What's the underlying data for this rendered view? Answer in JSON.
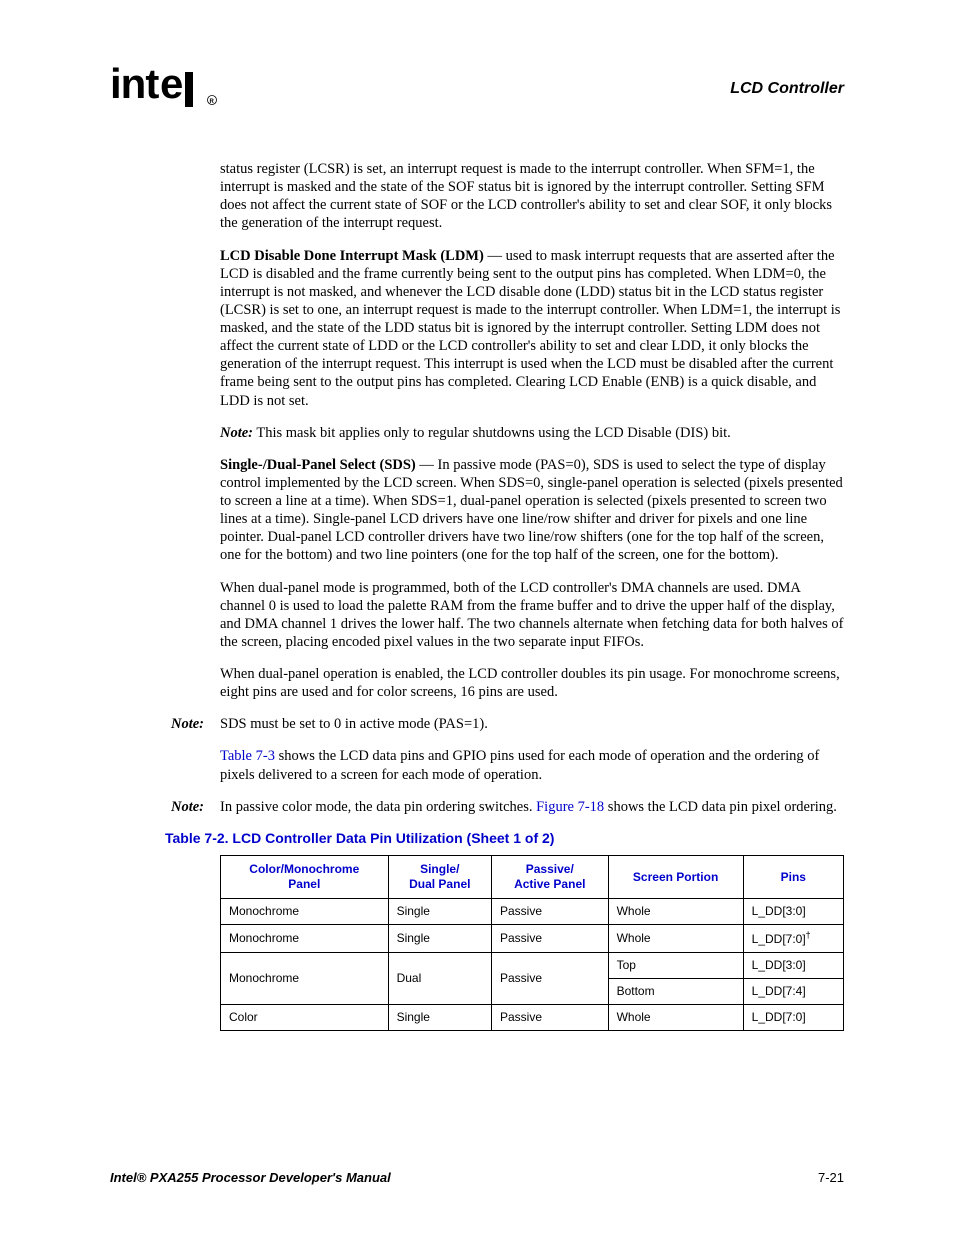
{
  "header": {
    "logo_text": "intel",
    "section_title": "LCD Controller"
  },
  "body": {
    "p1": "status register (LCSR) is set, an interrupt request is made to the interrupt controller. When SFM=1, the interrupt is masked and the state of the SOF status bit is ignored by the interrupt controller. Setting SFM does not affect the current state of SOF or the LCD controller's ability to set and clear SOF, it only blocks the generation of the interrupt request.",
    "p2_bold": "LCD Disable Done Interrupt Mask (LDM)",
    "p2_rest": " — used to mask interrupt requests that are asserted after the LCD is disabled and the frame currently being sent to the output pins has completed. When LDM=0, the interrupt is not masked, and whenever the LCD disable done (LDD) status bit in the LCD status register (LCSR) is set to one, an interrupt request is made to the interrupt controller. When LDM=1, the interrupt is masked, and the state of the LDD status bit is ignored by the interrupt controller. Setting LDM does not affect the current state of LDD or the LCD controller's ability to set and clear LDD, it only blocks the generation of the interrupt request. This interrupt is used when the LCD must be disabled after the current frame being sent to the output pins has completed. Clearing LCD Enable (ENB) is a quick disable, and LDD is not set.",
    "p3_note_label": "Note:",
    "p3_note_text": " This mask bit applies only to regular shutdowns using the LCD Disable (DIS) bit.",
    "p4_bold": "Single-/Dual-Panel Select (SDS)",
    "p4_rest": " — In passive mode (PAS=0), SDS is used to select the type of display control implemented by the LCD screen. When SDS=0, single-panel operation is selected (pixels presented to screen a line at a time). When SDS=1, dual-panel operation is selected (pixels presented to screen two lines at a time). Single-panel LCD drivers have one line/row shifter and driver for pixels and one line pointer. Dual-panel LCD controller drivers have two line/row shifters (one for the top half of the screen, one for the bottom) and two line pointers (one for the top half of the screen, one for the bottom).",
    "p5": "When dual-panel mode is programmed, both of the LCD controller's DMA channels are used. DMA channel 0 is used to load the palette RAM from the frame buffer and to drive the upper half of the display, and DMA channel 1 drives the lower half. The two channels alternate when fetching data for both halves of the screen, placing encoded pixel values in the two separate input FIFOs.",
    "p6": "When dual-panel operation is enabled, the LCD controller doubles its pin usage. For monochrome screens, eight pins are used and for color screens, 16 pins are used.",
    "note1_label": "Note:",
    "note1_text": "SDS must be set to 0 in active mode (PAS=1).",
    "p7_link": "Table 7-3",
    "p7_rest": " shows the LCD data pins and GPIO pins used for each mode of operation and the ordering of pixels delivered to a screen for each mode of operation.",
    "note2_label": "Note:",
    "note2_text_a": "In passive color mode, the data pin ordering switches. ",
    "note2_link": "Figure 7-18",
    "note2_text_b": " shows the LCD data pin pixel ordering."
  },
  "table": {
    "caption": "Table 7-2. LCD Controller Data Pin Utilization (Sheet 1 of 2)",
    "headers": {
      "h1a": "Color/Monochrome",
      "h1b": "Panel",
      "h2a": "Single/",
      "h2b": "Dual Panel",
      "h3a": "Passive/",
      "h3b": "Active Panel",
      "h4": "Screen Portion",
      "h5": "Pins"
    },
    "rows": {
      "r1": {
        "c1": "Monochrome",
        "c2": "Single",
        "c3": "Passive",
        "c4": "Whole",
        "c5": "L_DD[3:0]"
      },
      "r2": {
        "c1": "Monochrome",
        "c2": "Single",
        "c3": "Passive",
        "c4": "Whole",
        "c5": "L_DD[7:0]",
        "c5_sup": "†"
      },
      "r3": {
        "c1": "Monochrome",
        "c2": "Dual",
        "c3": "Passive",
        "c4a": "Top",
        "c5a": "L_DD[3:0]",
        "c4b": "Bottom",
        "c5b": "L_DD[7:4]"
      },
      "r4": {
        "c1": "Color",
        "c2": "Single",
        "c3": "Passive",
        "c4": "Whole",
        "c5": "L_DD[7:0]"
      }
    }
  },
  "footer": {
    "left": "Intel® PXA255 Processor Developer's Manual",
    "right": "7-21"
  }
}
